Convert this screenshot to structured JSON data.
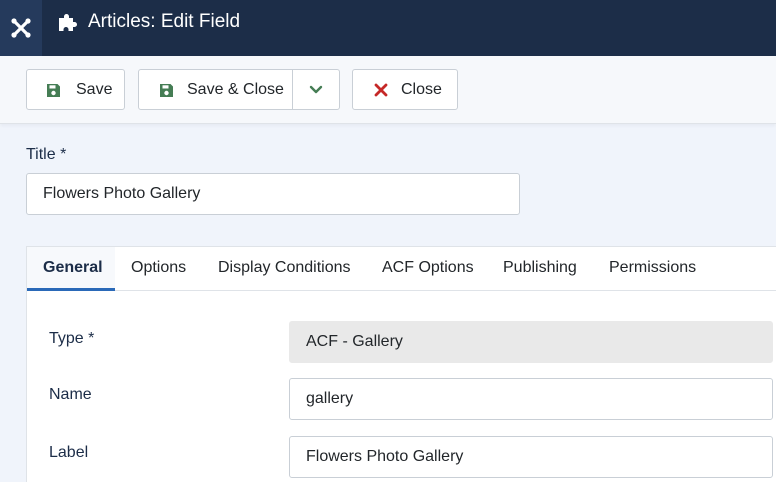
{
  "header": {
    "logo_icon": "joomla-icon",
    "page_icon": "puzzle-icon",
    "title": "Articles: Edit Field"
  },
  "toolbar": {
    "save_label": "Save",
    "save_close_label": "Save & Close",
    "dropdown_icon": "chevron-down-icon",
    "close_label": "Close"
  },
  "form": {
    "title_label": "Title *",
    "title_value": "Flowers Photo Gallery"
  },
  "tabs": [
    {
      "label": "General",
      "active": true
    },
    {
      "label": "Options",
      "active": false
    },
    {
      "label": "Display Conditions",
      "active": false
    },
    {
      "label": "ACF Options",
      "active": false
    },
    {
      "label": "Publishing",
      "active": false
    },
    {
      "label": "Permissions",
      "active": false
    }
  ],
  "fields": {
    "type_label": "Type *",
    "type_value": "ACF - Gallery",
    "name_label": "Name",
    "name_value": "gallery",
    "label_label": "Label",
    "label_value": "Flowers Photo Gallery"
  },
  "colors": {
    "header_bg": "#1c2d48",
    "accent": "#2a69b8",
    "success": "#457d54",
    "danger": "#c52827"
  }
}
